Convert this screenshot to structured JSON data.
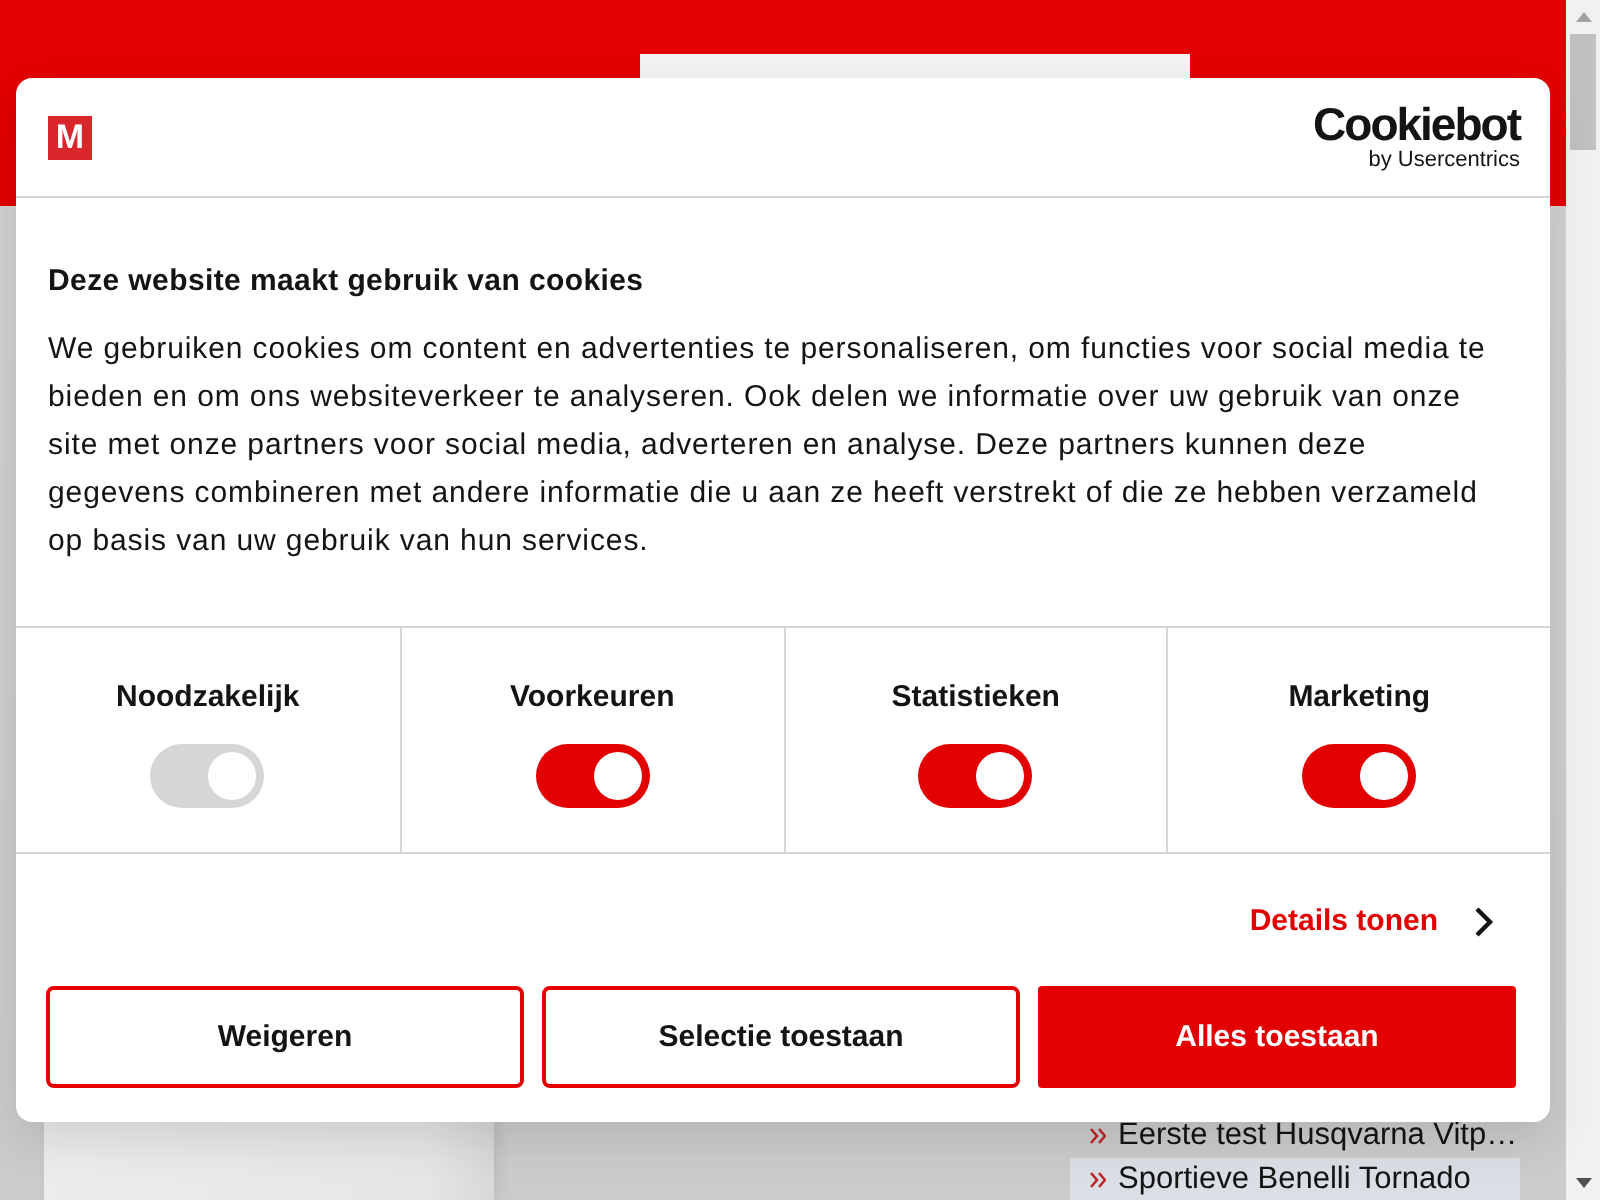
{
  "background": {
    "articles": [
      {
        "title": "Eerste test Husqvarna Vitp…",
        "highlighted": false
      },
      {
        "title": "Sportieve Benelli Tornado",
        "highlighted": true
      }
    ]
  },
  "dialog": {
    "logo_text": "M",
    "brand": {
      "name": "Cookiebot",
      "tagline": "by Usercentrics"
    },
    "title": "Deze website maakt gebruik van cookies",
    "body": "We gebruiken cookies om content en advertenties te personaliseren, om functies voor social media te bieden en om ons websiteverkeer te analyseren. Ook delen we informatie over uw gebruik van onze site met onze partners voor social media, adverteren en analyse. Deze partners kunnen deze gegevens combineren met andere informatie die u aan ze heeft verstrekt of die ze hebben verzameld op basis van uw gebruik van hun services.",
    "categories": [
      {
        "label": "Noodzakelijk",
        "on": true,
        "disabled": true
      },
      {
        "label": "Voorkeuren",
        "on": true,
        "disabled": false
      },
      {
        "label": "Statistieken",
        "on": true,
        "disabled": false
      },
      {
        "label": "Marketing",
        "on": true,
        "disabled": false
      }
    ],
    "details_link": "Details tonen",
    "buttons": [
      {
        "label": "Weigeren",
        "kind": "outline"
      },
      {
        "label": "Selectie toestaan",
        "kind": "outline"
      },
      {
        "label": "Alles toestaan",
        "kind": "filled"
      }
    ]
  }
}
